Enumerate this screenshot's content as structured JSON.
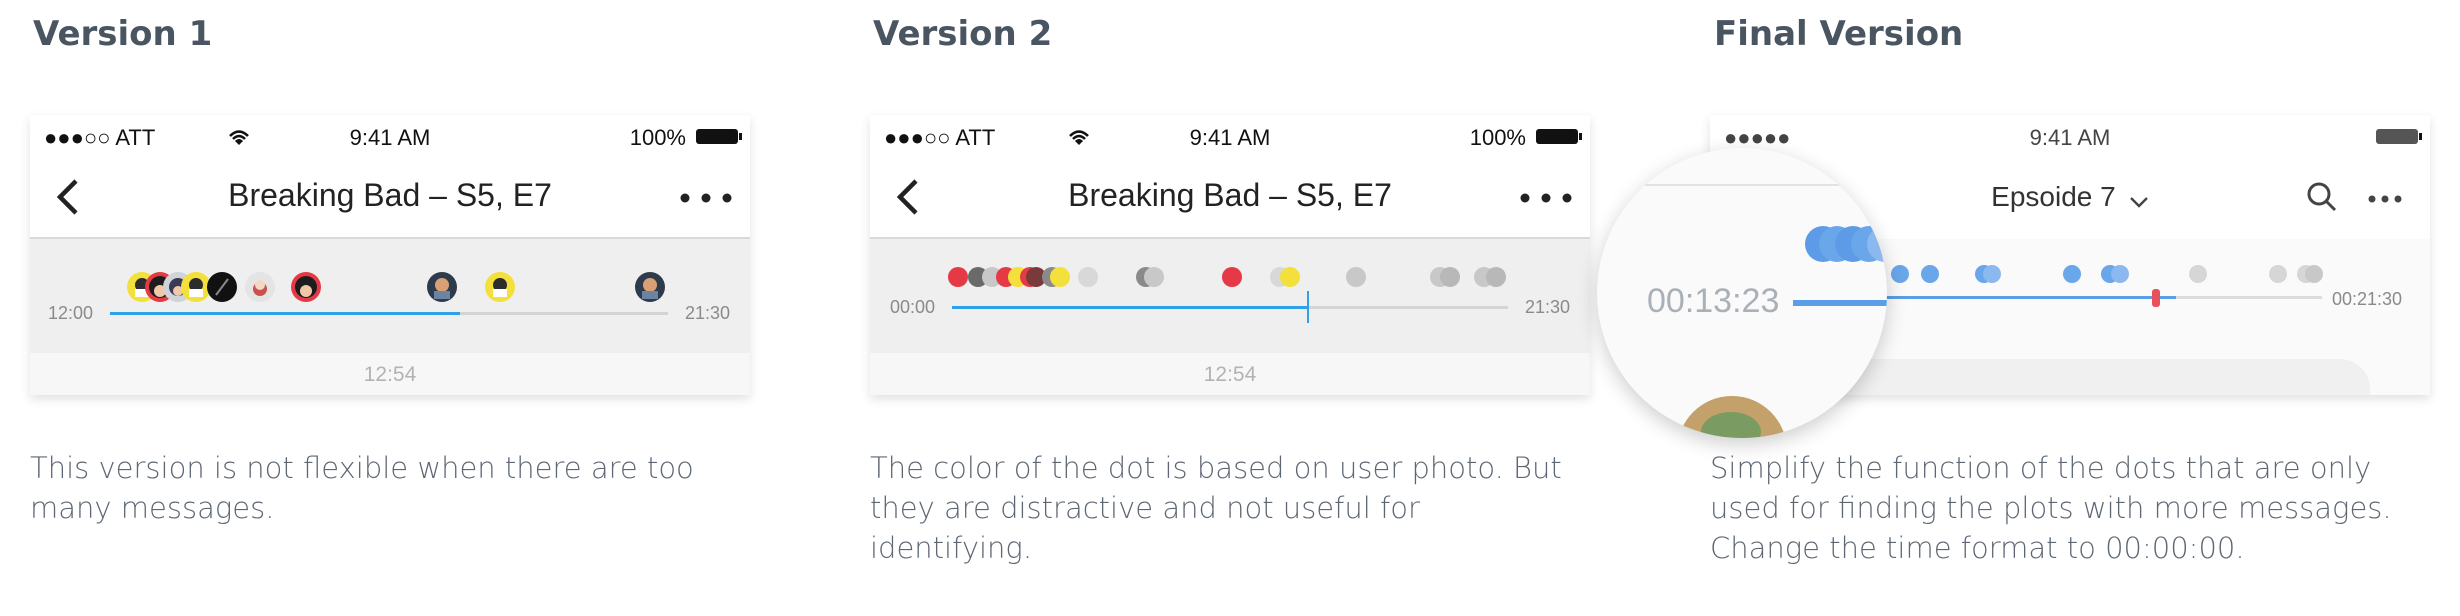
{
  "panels": [
    {
      "heading": "Version 1",
      "description": [
        "This version is not flexible when there are too",
        "many messages."
      ],
      "status": {
        "signal": "●●●○○ ATT",
        "time": "9:41 AM",
        "battery": "100%"
      },
      "nav": {
        "title": "Breaking Bad – S5, E7"
      },
      "timeline": {
        "start": "12:00",
        "end": "21:30",
        "current": "12:54"
      }
    },
    {
      "heading": "Version 2",
      "description": [
        "The color of the dot is based on user photo. But",
        "they are distractive and not useful for",
        "identifying."
      ],
      "status": {
        "signal": "●●●○○ ATT",
        "time": "9:41 AM",
        "battery": "100%"
      },
      "nav": {
        "title": "Breaking Bad – S5, E7"
      },
      "timeline": {
        "start": "00:00",
        "end": "21:30",
        "current": "12:54"
      }
    },
    {
      "heading": "Final Version",
      "description": [
        "Simplify the function of the dots that are only",
        "used for finding the plots with more messages.",
        "Change the time format to 00:00:00."
      ],
      "status": {
        "signal": "●●●●●",
        "time": "9:41 AM"
      },
      "nav": {
        "title": "Epsoide 7"
      },
      "timeline": {
        "end": "00:21:30",
        "current": "00:13:23"
      }
    }
  ],
  "colors": {
    "accent_blue": "#2fa1e8",
    "dot_red": "#e63946",
    "dot_yellow": "#f3e03b",
    "dot_gray": "#c8c8c8",
    "dot_blue": "#6aa6ea",
    "marker_red": "#e8505b"
  }
}
